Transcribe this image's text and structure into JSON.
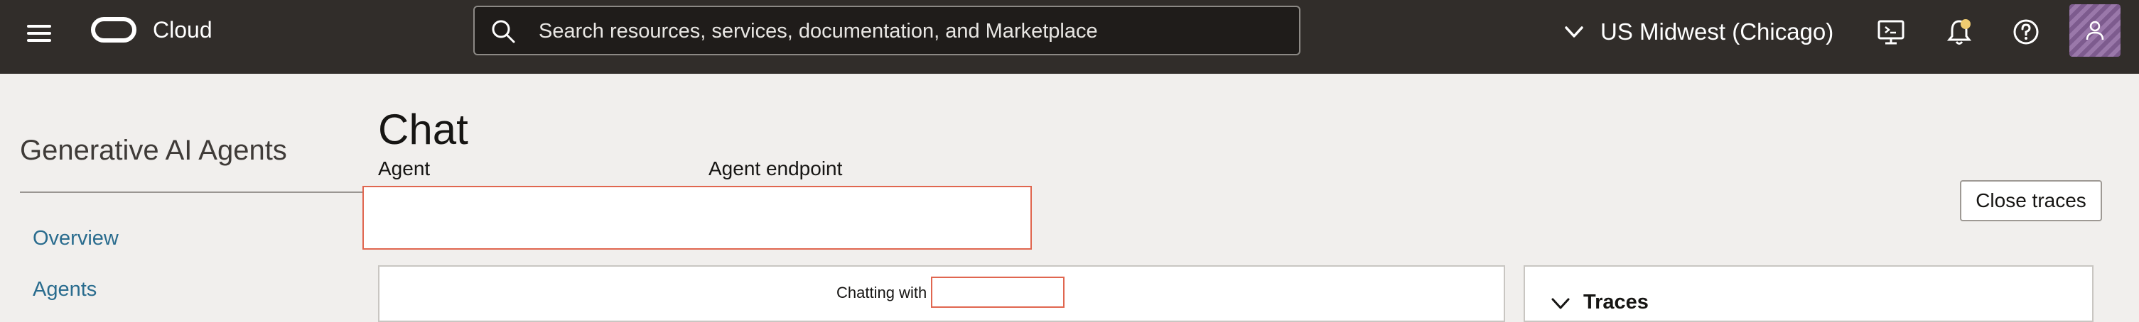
{
  "topbar": {
    "brand": "Cloud",
    "search": {
      "placeholder": "Search resources, services, documentation, and Marketplace"
    },
    "region": "US Midwest (Chicago)",
    "icons": [
      "menu-icon",
      "oracle-logo",
      "search-icon",
      "chevron-down-icon",
      "cloud-shell-icon",
      "bell-icon",
      "help-icon",
      "user-icon"
    ]
  },
  "nav": {
    "title": "Generative AI Agents",
    "items": [
      {
        "label": "Overview"
      },
      {
        "label": "Agents"
      }
    ]
  },
  "main": {
    "title": "Chat",
    "agent_label": "Agent",
    "endpoint_label": "Agent endpoint",
    "close_traces_label": "Close traces",
    "chatting_with_label": "Chatting with",
    "traces_title": "Traces"
  },
  "colors": {
    "topbar": "#312d2a",
    "link": "#2a6c8e",
    "highlight_border": "#e0664f",
    "background": "#f1efed"
  }
}
